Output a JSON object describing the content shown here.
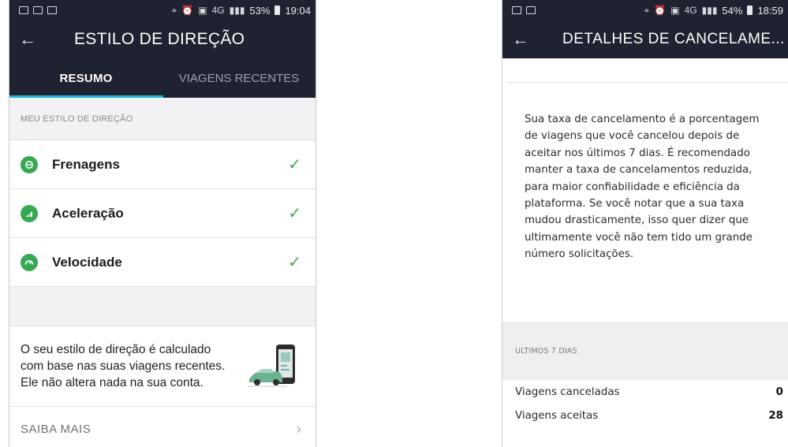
{
  "left": {
    "status": {
      "left_icons": [
        "screen-icon",
        "mail-icon",
        "gallery-icon"
      ],
      "battery": "53%",
      "time": "19:04",
      "net": "4G"
    },
    "title": "ESTILO DE DIREÇÃO",
    "tabs": [
      {
        "label": "RESUMO",
        "active": true
      },
      {
        "label": "VIAGENS RECENTES",
        "active": false
      }
    ],
    "section_label": "MEU ESTILO DE DIREÇÃO",
    "items": [
      {
        "label": "Frenagens",
        "icon": "brake-icon",
        "status": "ok"
      },
      {
        "label": "Aceleração",
        "icon": "acceleration-icon",
        "status": "ok"
      },
      {
        "label": "Velocidade",
        "icon": "speed-icon",
        "status": "ok"
      }
    ],
    "info_text": "O seu estilo de direção é calculado com base nas suas viagens recentes. Ele não altera nada na sua conta.",
    "learn_more": "SAIBA MAIS",
    "accent": "#1fbad6",
    "ok_color": "#36a852"
  },
  "right": {
    "status": {
      "left_icons": [
        "screen-icon",
        "gallery-icon"
      ],
      "battery": "54%",
      "time": "18:59",
      "net": "4G"
    },
    "title": "DETALHES DE CANCELAME...",
    "paragraph": "Sua taxa de cancelamento é a porcentagem de viagens que você cancelou depois de aceitar nos últimos 7 dias. É recomendado manter a taxa de cancelamentos reduzida, para maior confiabilidade e eficiência da plataforma. Se você notar que a sua taxa mudou drasticamente, isso quer dizer que ultimamente você não tem tido um grande número solicitações.",
    "section_label": "ULTIMOS 7 DIAS",
    "stats": [
      {
        "label": "Viagens canceladas",
        "value": "0"
      },
      {
        "label": "Viagens aceitas",
        "value": "28"
      }
    ]
  }
}
